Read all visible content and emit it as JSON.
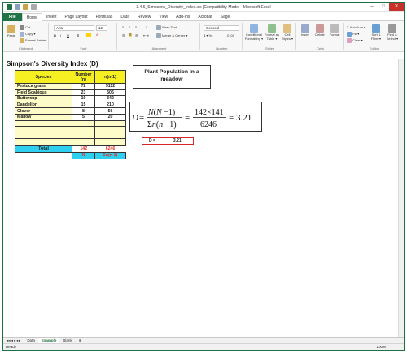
{
  "window": {
    "title": "3.4.6_Simpsons_Diversity_Index.xls [Compatibility Mode] - Microsoft Excel"
  },
  "tabs": [
    "File",
    "Home",
    "Insert",
    "Page Layout",
    "Formulas",
    "Data",
    "Review",
    "View",
    "Add-Ins",
    "Acrobat",
    "Sage"
  ],
  "active_tab": "Home",
  "ribbon": {
    "clipboard": {
      "paste": "Paste",
      "cut": "Cut",
      "copy": "Copy ▾",
      "painter": "Format Painter",
      "label": "Clipboard"
    },
    "font": {
      "name": "Arial",
      "size": "12",
      "label": "Font"
    },
    "alignment": {
      "wrap": "Wrap Text",
      "merge": "Merge & Center ▾",
      "label": "Alignment"
    },
    "number": {
      "format": "General",
      "label": "Number"
    },
    "styles": {
      "conditional": "Conditional Formatting ▾",
      "table": "Format as Table ▾",
      "cell": "Cell Styles ▾",
      "label": "Styles"
    },
    "cells": {
      "insert": "Insert",
      "delete": "Delete",
      "format": "Format",
      "label": "Cells"
    },
    "editing": {
      "autosum": "AutoSum ▾",
      "fill": "Fill ▾",
      "clear": "Clear ▾",
      "sort": "Sort & Filter ▾",
      "find": "Find & Select ▾",
      "label": "Editing"
    }
  },
  "sheet": {
    "title": "Simpson's Diversity Index (D)",
    "headers": {
      "species": "Species",
      "number": "Number (n)",
      "nn": "n(n-1)"
    },
    "rows": [
      {
        "species": "Festuca grass",
        "n": "72",
        "nn": "5112"
      },
      {
        "species": "Field Scabious",
        "n": "23",
        "nn": "506"
      },
      {
        "species": "Buttercup",
        "n": "19",
        "nn": "342"
      },
      {
        "species": "Dandelion",
        "n": "15",
        "nn": "210"
      },
      {
        "species": "Clover",
        "n": "8",
        "nn": "56"
      },
      {
        "species": "Mallow",
        "n": "5",
        "nn": "20"
      }
    ],
    "total_label": "Total",
    "total_n": "142",
    "total_nn": "6246",
    "symbol_n": "N",
    "symbol_nn": "Σn(n-1)",
    "note": "Plant Population in a meadow",
    "d_label": "D =",
    "d_value": "3.21"
  },
  "sheet_tabs": [
    "Data",
    "Example",
    "Blank"
  ],
  "active_sheet": "Example",
  "status": {
    "ready": "Ready",
    "zoom": "100%"
  }
}
